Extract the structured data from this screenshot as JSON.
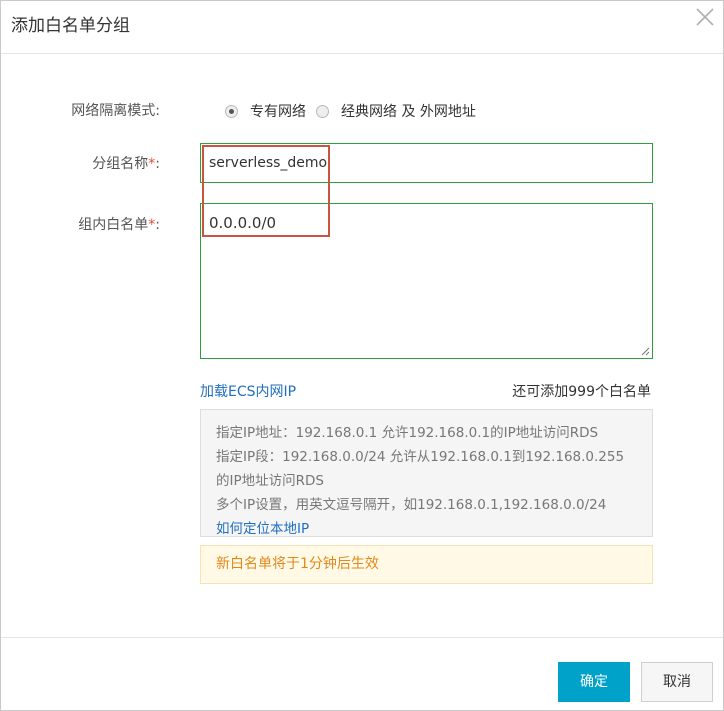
{
  "dialog": {
    "title": "添加白名单分组"
  },
  "form": {
    "network_mode": {
      "label": "网络隔离模式:",
      "options": [
        {
          "label": "专有网络",
          "selected": true
        },
        {
          "label": "经典网络 及 外网地址",
          "selected": false
        }
      ]
    },
    "group_name": {
      "label": "分组名称",
      "required_mark": "*",
      "label_suffix": ":",
      "value": "serverless_demo"
    },
    "whitelist": {
      "label": "组内白名单",
      "required_mark": "*",
      "label_suffix": ":",
      "value": "0.0.0.0/0"
    },
    "load_ecs_link": "加载ECS内网IP",
    "remaining_text": "还可添加999个白名单",
    "help_lines": [
      "指定IP地址：192.168.0.1 允许192.168.0.1的IP地址访问RDS",
      "指定IP段：192.168.0.0/24 允许从192.168.0.1到192.168.0.255",
      "的IP地址访问RDS",
      "多个IP设置，用英文逗号隔开，如192.168.0.1,192.168.0.0/24"
    ],
    "help_link": "如何定位本地IP",
    "notice": "新白名单将于1分钟后生效"
  },
  "footer": {
    "confirm_label": "确定",
    "cancel_label": "取消"
  },
  "colors": {
    "primary": "#00a2ca",
    "input_border": "#2f9e3f",
    "highlight": "#c8553d",
    "link": "#1f6fbf",
    "notice_text": "#e08a1e"
  }
}
